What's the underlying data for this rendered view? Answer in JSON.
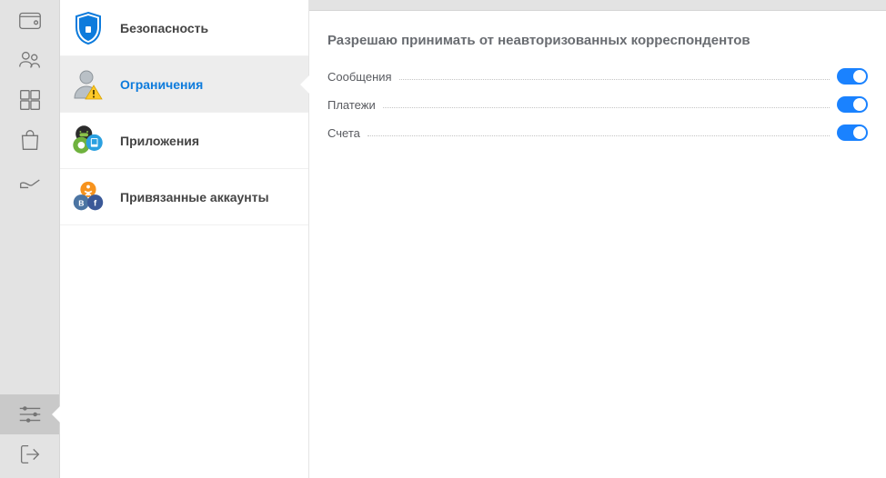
{
  "sidebar": {
    "items": [
      {
        "label": "Безопасность"
      },
      {
        "label": "Ограничения"
      },
      {
        "label": "Приложения"
      },
      {
        "label": "Привязанные аккаунты"
      }
    ]
  },
  "main": {
    "section_title": "Разрешаю принимать от неавторизованных корреспондентов",
    "options": [
      {
        "label": "Сообщения",
        "on": true
      },
      {
        "label": "Платежи",
        "on": true
      },
      {
        "label": "Счета",
        "on": true
      }
    ]
  }
}
